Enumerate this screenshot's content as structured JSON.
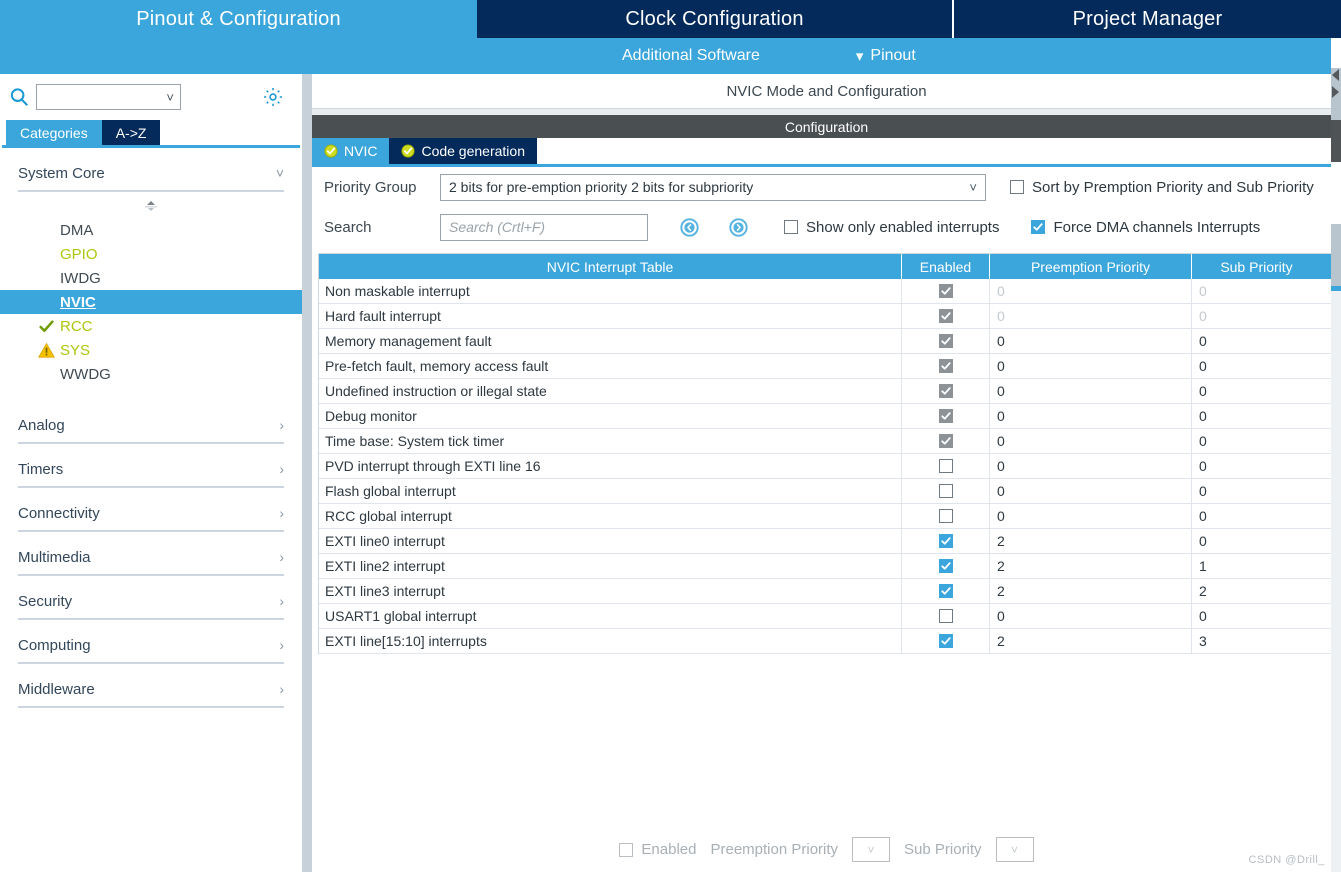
{
  "top_tabs": [
    {
      "label": "Pinout & Configuration",
      "active": true
    },
    {
      "label": "Clock Configuration",
      "active": false
    },
    {
      "label": "Project Manager",
      "active": false
    }
  ],
  "subbar": {
    "additional_software": "Additional Software",
    "pinout": "Pinout",
    "chevron_icon": "chevron-down-icon"
  },
  "sidebar": {
    "search_placeholder": "",
    "search_icon": "search-icon",
    "gear_icon": "gear-icon",
    "tabs": [
      {
        "label": "Categories",
        "active": true
      },
      {
        "label": "A->Z",
        "active": false
      }
    ],
    "system_core": {
      "label": "System Core",
      "expanded": true,
      "chevron_icon": "chevron-down-icon",
      "items": [
        {
          "label": "DMA",
          "state": "normal",
          "icon": ""
        },
        {
          "label": "GPIO",
          "state": "green",
          "icon": ""
        },
        {
          "label": "IWDG",
          "state": "normal",
          "icon": ""
        },
        {
          "label": "NVIC",
          "state": "selected",
          "icon": ""
        },
        {
          "label": "RCC",
          "state": "green",
          "icon": "check-icon"
        },
        {
          "label": "SYS",
          "state": "green",
          "icon": "warning-icon"
        },
        {
          "label": "WWDG",
          "state": "normal",
          "icon": ""
        }
      ]
    },
    "categories": [
      {
        "label": "Analog",
        "chevron_icon": "chevron-right-icon"
      },
      {
        "label": "Timers",
        "chevron_icon": "chevron-right-icon"
      },
      {
        "label": "Connectivity",
        "chevron_icon": "chevron-right-icon"
      },
      {
        "label": "Multimedia",
        "chevron_icon": "chevron-right-icon"
      },
      {
        "label": "Security",
        "chevron_icon": "chevron-right-icon"
      },
      {
        "label": "Computing",
        "chevron_icon": "chevron-right-icon"
      },
      {
        "label": "Middleware",
        "chevron_icon": "chevron-right-icon"
      }
    ]
  },
  "main": {
    "mode_header": "NVIC Mode and Configuration",
    "configuration_bar": "Configuration",
    "tabs": [
      {
        "label": "NVIC",
        "active": true,
        "icon": "check-circle-icon"
      },
      {
        "label": "Code generation",
        "active": false,
        "icon": "check-circle-icon"
      }
    ],
    "priority_group": {
      "label": "Priority Group",
      "value": "2 bits for pre-emption priority 2 bits for subpriority",
      "chevron_icon": "chevron-down-icon"
    },
    "sort_checkbox": {
      "label": "Sort by Premption Priority and Sub Priority",
      "checked": false
    },
    "search": {
      "label": "Search",
      "placeholder": "Search (Crtl+F)",
      "value": "",
      "prev_icon": "circle-left-arrow-icon",
      "next_icon": "circle-right-arrow-icon"
    },
    "show_only_enabled": {
      "label": "Show only enabled interrupts",
      "checked": false
    },
    "force_dma": {
      "label": "Force DMA channels Interrupts",
      "checked": true
    },
    "table": {
      "headers": [
        "NVIC Interrupt Table",
        "Enabled",
        "Preemption Priority",
        "Sub Priority"
      ],
      "rows": [
        {
          "name": "Non maskable interrupt",
          "enabled": true,
          "locked": true,
          "preemption": "0",
          "sub": "0",
          "dim": true
        },
        {
          "name": "Hard fault interrupt",
          "enabled": true,
          "locked": true,
          "preemption": "0",
          "sub": "0",
          "dim": true
        },
        {
          "name": "Memory management fault",
          "enabled": true,
          "locked": true,
          "preemption": "0",
          "sub": "0",
          "dim": false
        },
        {
          "name": "Pre-fetch fault, memory access fault",
          "enabled": true,
          "locked": true,
          "preemption": "0",
          "sub": "0",
          "dim": false
        },
        {
          "name": "Undefined instruction or illegal state",
          "enabled": true,
          "locked": true,
          "preemption": "0",
          "sub": "0",
          "dim": false
        },
        {
          "name": "Debug monitor",
          "enabled": true,
          "locked": true,
          "preemption": "0",
          "sub": "0",
          "dim": false
        },
        {
          "name": "Time base: System tick timer",
          "enabled": true,
          "locked": true,
          "preemption": "0",
          "sub": "0",
          "dim": false
        },
        {
          "name": "PVD interrupt through EXTI line 16",
          "enabled": false,
          "locked": false,
          "preemption": "0",
          "sub": "0",
          "dim": false
        },
        {
          "name": "Flash global interrupt",
          "enabled": false,
          "locked": false,
          "preemption": "0",
          "sub": "0",
          "dim": false
        },
        {
          "name": "RCC global interrupt",
          "enabled": false,
          "locked": false,
          "preemption": "0",
          "sub": "0",
          "dim": false
        },
        {
          "name": "EXTI line0 interrupt",
          "enabled": true,
          "locked": false,
          "preemption": "2",
          "sub": "0",
          "dim": false
        },
        {
          "name": "EXTI line2 interrupt",
          "enabled": true,
          "locked": false,
          "preemption": "2",
          "sub": "1",
          "dim": false
        },
        {
          "name": "EXTI line3 interrupt",
          "enabled": true,
          "locked": false,
          "preemption": "2",
          "sub": "2",
          "dim": false
        },
        {
          "name": "USART1 global interrupt",
          "enabled": false,
          "locked": false,
          "preemption": "0",
          "sub": "0",
          "dim": false
        },
        {
          "name": "EXTI line[15:10] interrupts",
          "enabled": true,
          "locked": false,
          "preemption": "2",
          "sub": "3",
          "dim": false
        }
      ]
    },
    "footer": {
      "enabled_label": "Enabled",
      "preemption_label": "Preemption Priority",
      "preemption_value": "",
      "sub_label": "Sub Priority",
      "sub_value": "",
      "chevron_icon": "chevron-down-icon"
    }
  },
  "watermark": "CSDN @Drill_",
  "colors": {
    "accent_blue": "#3aa6dc",
    "dark_navy": "#032a5a",
    "green_text": "#a9c90d",
    "warning_orange": "#f2b705",
    "gray_bar": "#4a4f51"
  }
}
